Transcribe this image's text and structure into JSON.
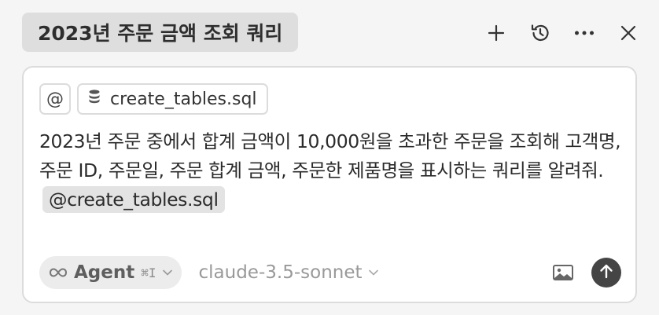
{
  "header": {
    "title": "2023년 주문 금액 조회 쿼리",
    "icons": [
      "plus-icon",
      "history-icon",
      "more-icon",
      "close-icon"
    ]
  },
  "composer": {
    "at_symbol": "@",
    "file_chip_label": "create_tables.sql",
    "file_chip_icon": "database-icon",
    "prompt_text": "2023년 주문 중에서 합계 금액이 10,000원을 초과한 주문을 조회해 고객명, 주문 ID, 주문일, 주문 합계 금액, 주문한 제품명을 표시하는 쿼리를 알려줘.",
    "mention_label": "@create_tables.sql",
    "mode": {
      "icon": "infinity-icon",
      "label": "Agent",
      "shortcut": "⌘I"
    },
    "model": {
      "label": "claude-3.5-sonnet"
    },
    "image_icon": "image-icon",
    "send_icon": "arrow-up-icon"
  },
  "colors": {
    "background": "#f5f5f5",
    "title_chip": "#dedede",
    "composer_bg": "#ffffff",
    "border": "#dcdcdc",
    "send_button": "#454545"
  }
}
